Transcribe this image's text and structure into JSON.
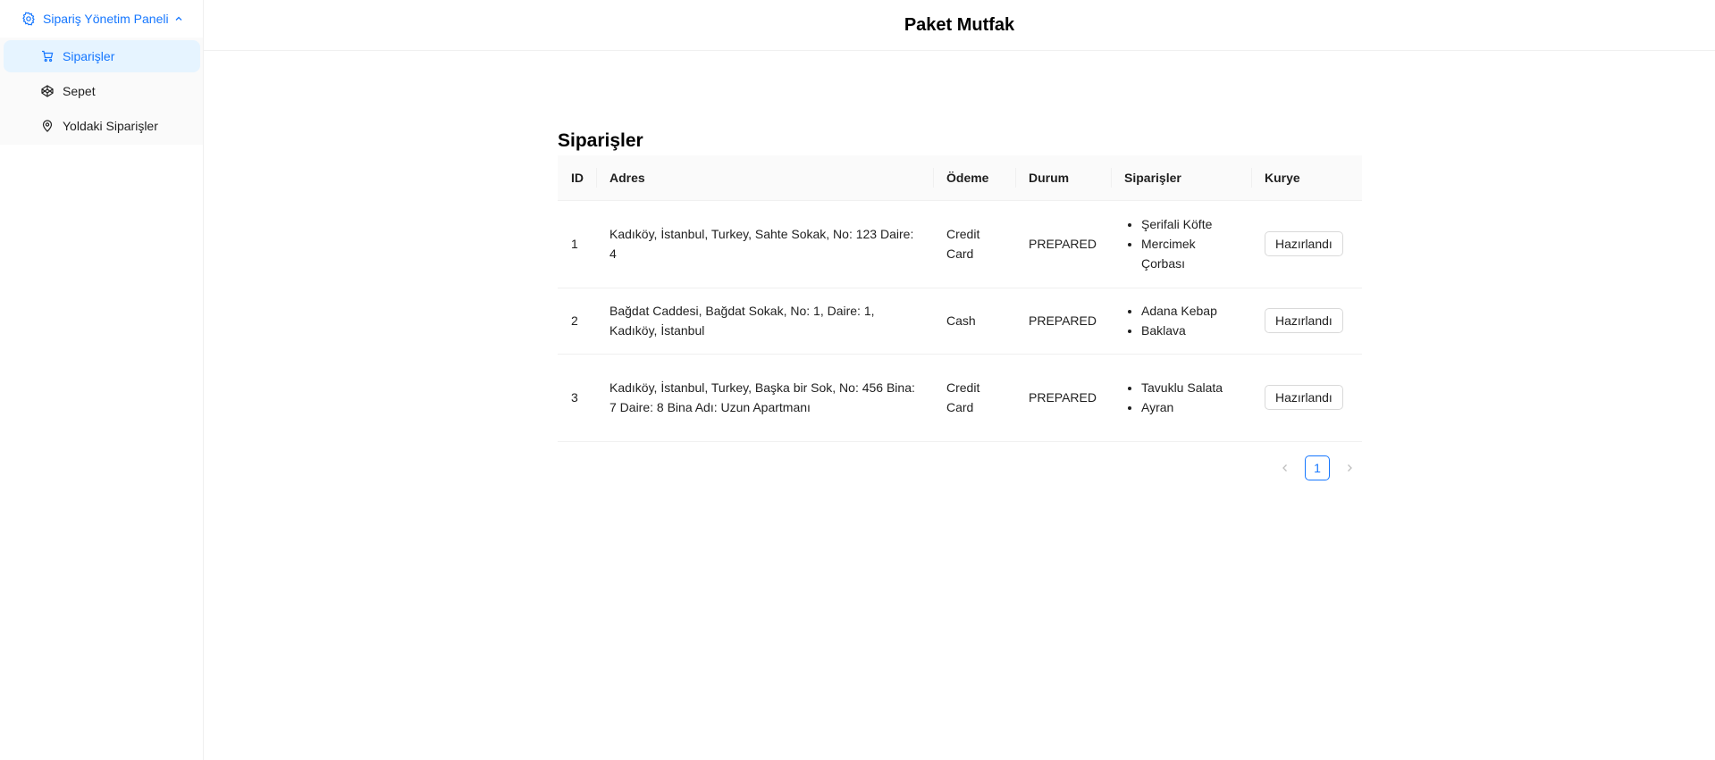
{
  "sidebar": {
    "group_title": "Sipariş Yönetim Paneli",
    "items": [
      {
        "label": "Siparişler",
        "icon": "cart-icon",
        "active": true
      },
      {
        "label": "Sepet",
        "icon": "codepen-icon",
        "active": false
      },
      {
        "label": "Yoldaki Siparişler",
        "icon": "location-icon",
        "active": false
      }
    ]
  },
  "header": {
    "title": "Paket Mutfak"
  },
  "main": {
    "title": "Siparişler",
    "columns": [
      "ID",
      "Adres",
      "Ödeme",
      "Durum",
      "Siparişler",
      "Kurye"
    ],
    "rows": [
      {
        "id": "1",
        "address": "Kadıköy, İstanbul, Turkey, Sahte Sokak, No: 123 Daire: 4",
        "payment": "Credit Card",
        "status": "PREPARED",
        "items": [
          "Şerifali Köfte",
          "Mercimek Çorbası"
        ],
        "action": "Hazırlandı"
      },
      {
        "id": "2",
        "address": "Bağdat Caddesi, Bağdat Sokak, No: 1, Daire: 1, Kadıköy, İstanbul",
        "payment": "Cash",
        "status": "PREPARED",
        "items": [
          "Adana Kebap",
          "Baklava"
        ],
        "action": "Hazırlandı"
      },
      {
        "id": "3",
        "address": "Kadıköy, İstanbul, Turkey, Başka bir Sok, No: 456 Bina: 7 Daire: 8 Bina Adı: Uzun Apartmanı",
        "payment": "Credit Card",
        "status": "PREPARED",
        "items": [
          "Tavuklu Salata",
          "Ayran"
        ],
        "action": "Hazırlandı"
      }
    ]
  },
  "pagination": {
    "current_page": "1"
  },
  "colors": {
    "accent": "#1677ff",
    "active_bg": "#e6f4ff",
    "header_bg": "#fafafa",
    "border": "#f0f0f0"
  }
}
